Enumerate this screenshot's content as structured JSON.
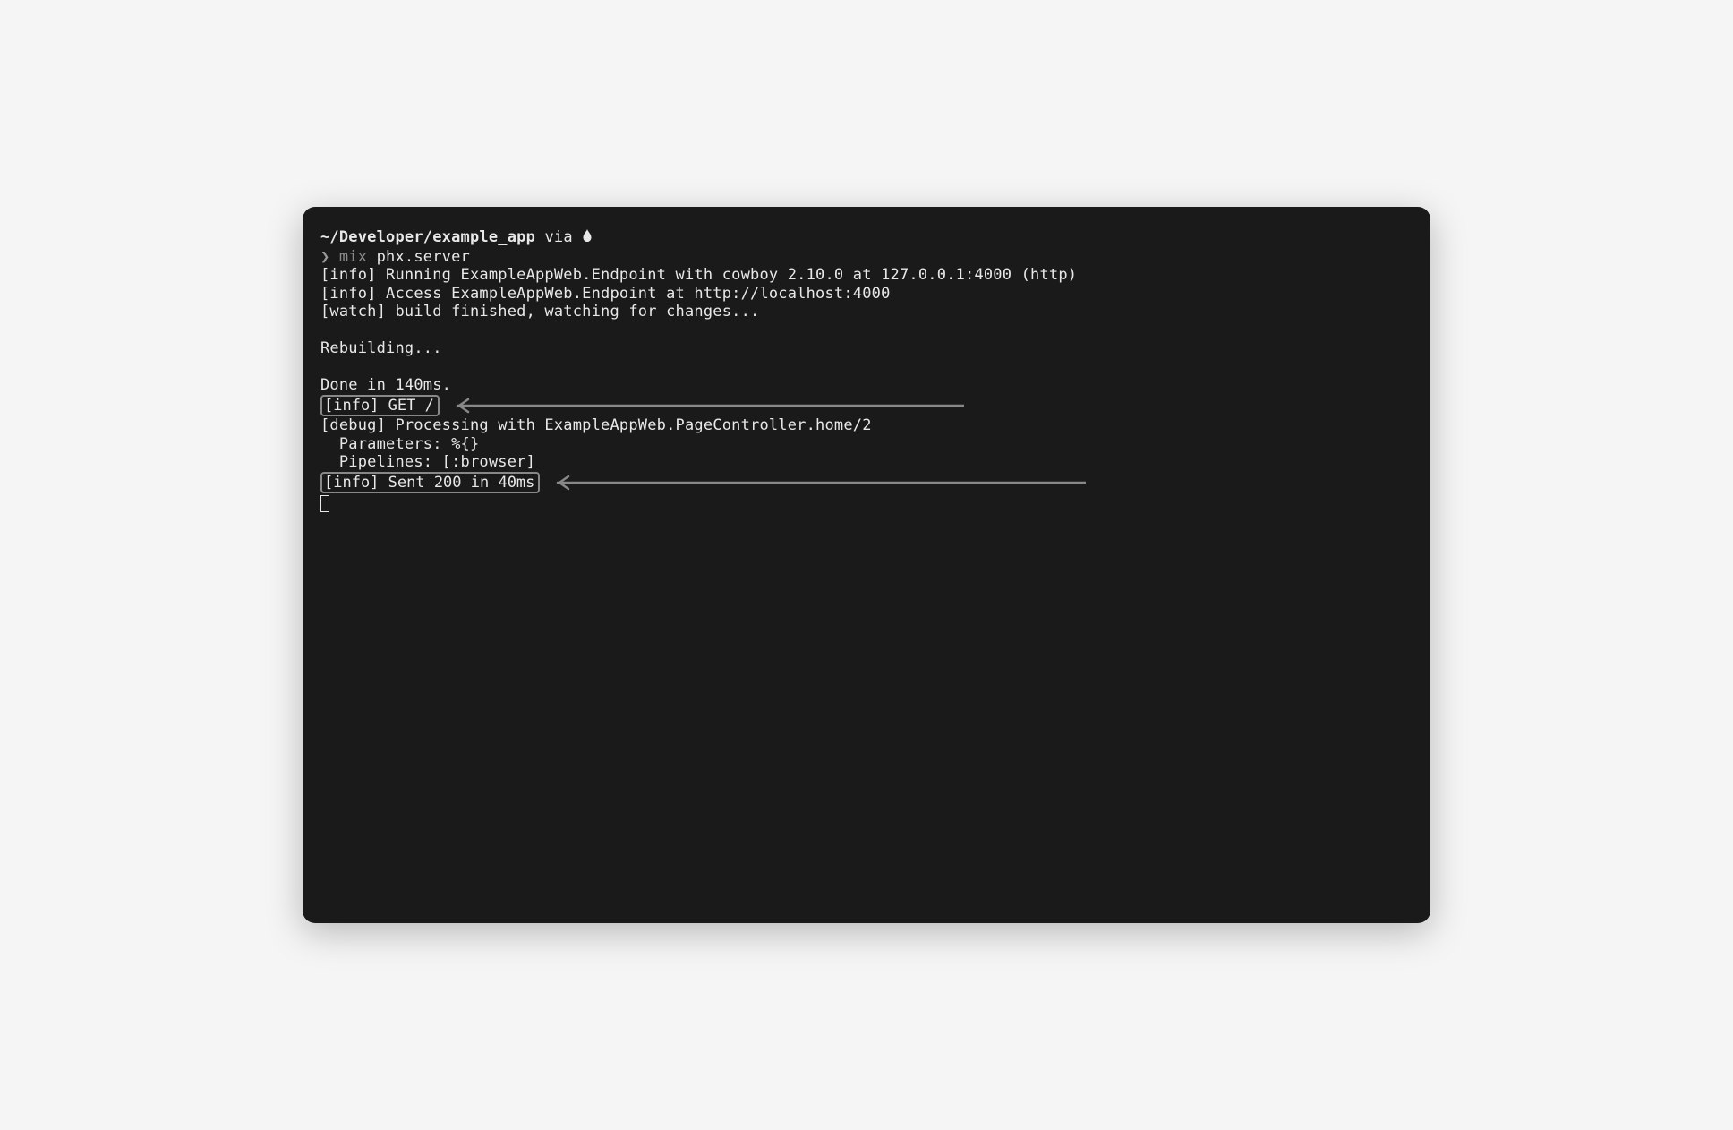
{
  "prompt": {
    "path": "~/Developer/example_app",
    "via": " via ",
    "char": "❯ ",
    "cmd_dim": "mix ",
    "cmd": "phx.server"
  },
  "lines": {
    "l1": "[info] Running ExampleAppWeb.Endpoint with cowboy 2.10.0 at 127.0.0.1:4000 (http)",
    "l2": "[info] Access ExampleAppWeb.Endpoint at http://localhost:4000",
    "l3": "[watch] build finished, watching for changes...",
    "l4": "Rebuilding...",
    "l5": "Done in 140ms.",
    "h1": "[info] GET /",
    "l6": "[debug] Processing with ExampleAppWeb.PageController.home/2",
    "l7": "  Parameters: %{}",
    "l8": "  Pipelines: [:browser]",
    "h2": "[info] Sent 200 in 40ms"
  },
  "arrows": {
    "w1": 580,
    "w2": 604
  }
}
